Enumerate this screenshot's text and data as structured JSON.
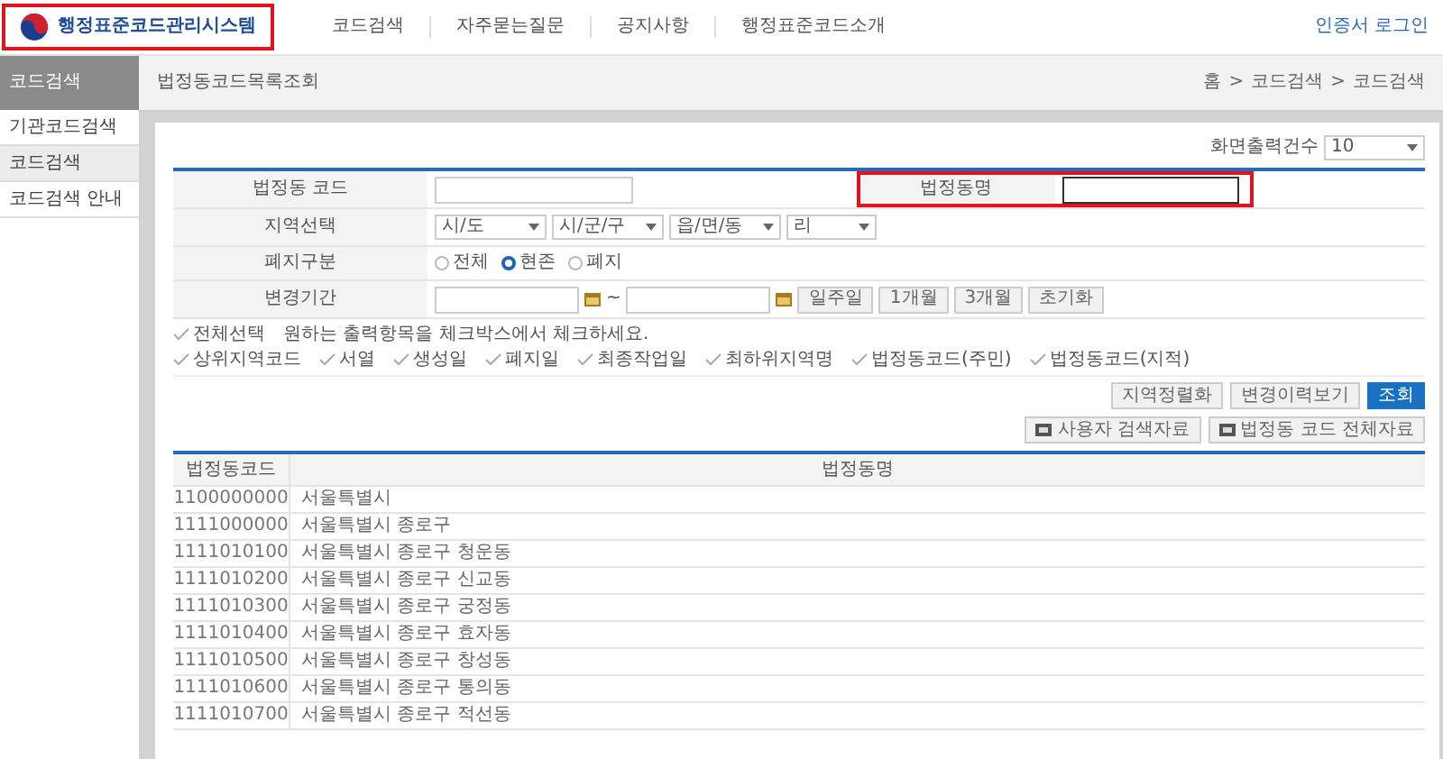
{
  "header": {
    "logo": {
      "text": "행정표준코드관리시스템",
      "highlighted": true
    },
    "nav": [
      "코드검색",
      "자주묻는질문",
      "공지사항",
      "행정표준코드소개"
    ],
    "login": "인증서 로그인"
  },
  "sidebar": {
    "title": "코드검색",
    "items": [
      {
        "label": "기관코드검색",
        "selected": false
      },
      {
        "label": "코드검색",
        "selected": true
      },
      {
        "label": "코드검색 안내",
        "selected": false
      }
    ]
  },
  "page": {
    "title": "법정동코드목록조회",
    "breadcrumb": [
      "홈",
      ">",
      "코드검색",
      ">",
      "코드검색"
    ]
  },
  "page_size": {
    "label": "화면출력건수",
    "value": "10"
  },
  "form": {
    "code_label": "법정동 코드",
    "name_label": "법정동명",
    "name_highlighted": true,
    "region_label": "지역선택",
    "regions": [
      "시/도",
      "시/군/구",
      "읍/면/동",
      "리"
    ],
    "status_label": "폐지구분",
    "status_options": [
      {
        "label": "전체",
        "selected": false
      },
      {
        "label": "현존",
        "selected": true
      },
      {
        "label": "폐지",
        "selected": false
      }
    ],
    "period_label": "변경기간",
    "period_sep": "~",
    "period_buttons": [
      "일주일",
      "1개월",
      "3개월",
      "초기화"
    ]
  },
  "columns": {
    "select_all": {
      "label": "전체선택",
      "checked": false
    },
    "hint": "원하는 출력항목을 체크박스에서 체크하세요.",
    "items": [
      {
        "label": "상위지역코드",
        "checked": false
      },
      {
        "label": "서열",
        "checked": false
      },
      {
        "label": "생성일",
        "checked": false
      },
      {
        "label": "폐지일",
        "checked": false
      },
      {
        "label": "최종작업일",
        "checked": false
      },
      {
        "label": "최하위지역명",
        "checked": false
      },
      {
        "label": "법정동코드(주민)",
        "checked": false
      },
      {
        "label": "법정동코드(지적)",
        "checked": false
      }
    ]
  },
  "actions": [
    {
      "label": "지역정렬화",
      "kind": "plain"
    },
    {
      "label": "변경이력보기",
      "kind": "plain"
    },
    {
      "label": "조회",
      "kind": "primary"
    }
  ],
  "downloads": [
    "사용자 검색자료",
    "법정동 코드 전체자료"
  ],
  "table": {
    "columns": [
      "법정동코드",
      "법정동명"
    ],
    "rows": [
      [
        "1100000000",
        "서울특별시"
      ],
      [
        "1111000000",
        "서울특별시 종로구"
      ],
      [
        "1111010100",
        "서울특별시 종로구 청운동"
      ],
      [
        "1111010200",
        "서울특별시 종로구 신교동"
      ],
      [
        "1111010300",
        "서울특별시 종로구 궁정동"
      ],
      [
        "1111010400",
        "서울특별시 종로구 효자동"
      ],
      [
        "1111010500",
        "서울특별시 종로구 창성동"
      ],
      [
        "1111010600",
        "서울특별시 종로구 통의동"
      ],
      [
        "1111010700",
        "서울특별시 종로구 적선동"
      ]
    ]
  }
}
